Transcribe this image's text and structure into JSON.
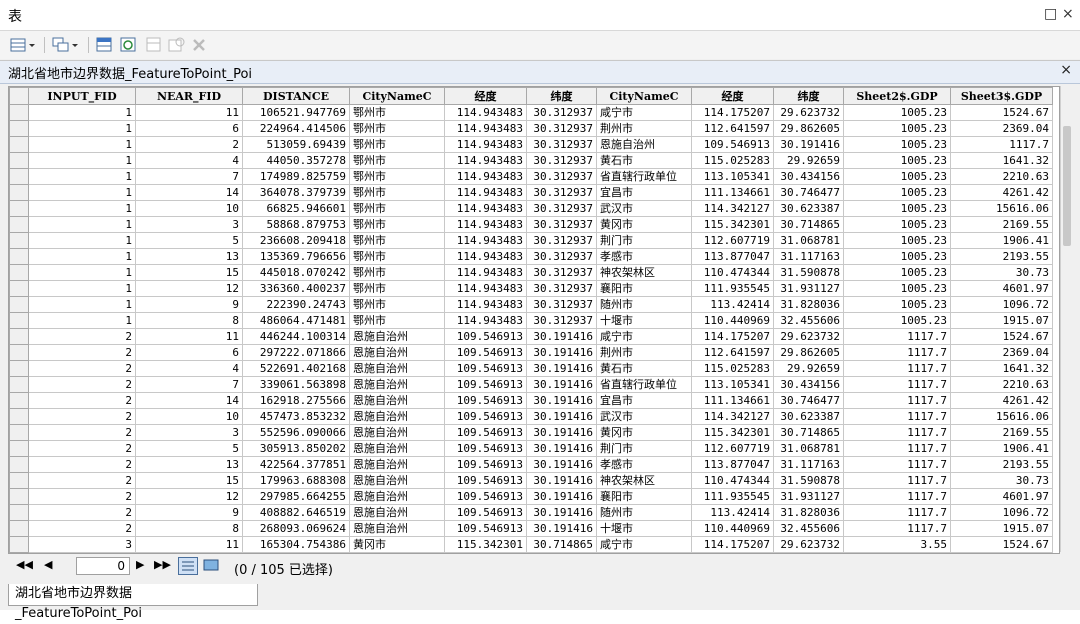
{
  "window": {
    "title": "表",
    "maximize_glyph": "□",
    "close_glyph": "×"
  },
  "toolbar": {
    "icons": [
      "table-options-icon",
      "related-tables-icon",
      "select-by-attributes-icon",
      "switch-selection-icon",
      "clear-selection-icon",
      "zoom-to-selected-icon",
      "delete-selected-icon"
    ]
  },
  "tab": {
    "title": "湖北省地市边界数据_FeatureToPoint_Poi",
    "close_glyph": "×"
  },
  "columns": [
    "",
    "INPUT_FID",
    "NEAR_FID",
    "DISTANCE",
    "CityNameC",
    "经度",
    "纬度",
    "CityNameC",
    "经度",
    "纬度",
    "Sheet2$.GDP",
    "Sheet3$.GDP"
  ],
  "rows": [
    [
      "1",
      "11",
      "106521.947769",
      "鄂州市",
      "114.943483",
      "30.312937",
      "咸宁市",
      "114.175207",
      "29.623732",
      "1005.23",
      "1524.67"
    ],
    [
      "1",
      "6",
      "224964.414506",
      "鄂州市",
      "114.943483",
      "30.312937",
      "荆州市",
      "112.641597",
      "29.862605",
      "1005.23",
      "2369.04"
    ],
    [
      "1",
      "2",
      "513059.69439",
      "鄂州市",
      "114.943483",
      "30.312937",
      "恩施自治州",
      "109.546913",
      "30.191416",
      "1005.23",
      "1117.7"
    ],
    [
      "1",
      "4",
      "44050.357278",
      "鄂州市",
      "114.943483",
      "30.312937",
      "黄石市",
      "115.025283",
      "29.92659",
      "1005.23",
      "1641.32"
    ],
    [
      "1",
      "7",
      "174989.825759",
      "鄂州市",
      "114.943483",
      "30.312937",
      "省直辖行政单位",
      "113.105341",
      "30.434156",
      "1005.23",
      "2210.63"
    ],
    [
      "1",
      "14",
      "364078.379739",
      "鄂州市",
      "114.943483",
      "30.312937",
      "宜昌市",
      "111.134661",
      "30.746477",
      "1005.23",
      "4261.42"
    ],
    [
      "1",
      "10",
      "66825.946601",
      "鄂州市",
      "114.943483",
      "30.312937",
      "武汉市",
      "114.342127",
      "30.623387",
      "1005.23",
      "15616.06"
    ],
    [
      "1",
      "3",
      "58868.879753",
      "鄂州市",
      "114.943483",
      "30.312937",
      "黄冈市",
      "115.342301",
      "30.714865",
      "1005.23",
      "2169.55"
    ],
    [
      "1",
      "5",
      "236608.209418",
      "鄂州市",
      "114.943483",
      "30.312937",
      "荆门市",
      "112.607719",
      "31.068781",
      "1005.23",
      "1906.41"
    ],
    [
      "1",
      "13",
      "135369.796656",
      "鄂州市",
      "114.943483",
      "30.312937",
      "孝感市",
      "113.877047",
      "31.117163",
      "1005.23",
      "2193.55"
    ],
    [
      "1",
      "15",
      "445018.070242",
      "鄂州市",
      "114.943483",
      "30.312937",
      "神农架林区",
      "110.474344",
      "31.590878",
      "1005.23",
      "30.73"
    ],
    [
      "1",
      "12",
      "336360.400237",
      "鄂州市",
      "114.943483",
      "30.312937",
      "襄阳市",
      "111.935545",
      "31.931127",
      "1005.23",
      "4601.97"
    ],
    [
      "1",
      "9",
      "222390.24743",
      "鄂州市",
      "114.943483",
      "30.312937",
      "随州市",
      "113.42414",
      "31.828036",
      "1005.23",
      "1096.72"
    ],
    [
      "1",
      "8",
      "486064.471481",
      "鄂州市",
      "114.943483",
      "30.312937",
      "十堰市",
      "110.440969",
      "32.455606",
      "1005.23",
      "1915.07"
    ],
    [
      "2",
      "11",
      "446244.100314",
      "恩施自治州",
      "109.546913",
      "30.191416",
      "咸宁市",
      "114.175207",
      "29.623732",
      "1117.7",
      "1524.67"
    ],
    [
      "2",
      "6",
      "297222.071866",
      "恩施自治州",
      "109.546913",
      "30.191416",
      "荆州市",
      "112.641597",
      "29.862605",
      "1117.7",
      "2369.04"
    ],
    [
      "2",
      "4",
      "522691.402168",
      "恩施自治州",
      "109.546913",
      "30.191416",
      "黄石市",
      "115.025283",
      "29.92659",
      "1117.7",
      "1641.32"
    ],
    [
      "2",
      "7",
      "339061.563898",
      "恩施自治州",
      "109.546913",
      "30.191416",
      "省直辖行政单位",
      "113.105341",
      "30.434156",
      "1117.7",
      "2210.63"
    ],
    [
      "2",
      "14",
      "162918.275566",
      "恩施自治州",
      "109.546913",
      "30.191416",
      "宜昌市",
      "111.134661",
      "30.746477",
      "1117.7",
      "4261.42"
    ],
    [
      "2",
      "10",
      "457473.853232",
      "恩施自治州",
      "109.546913",
      "30.191416",
      "武汉市",
      "114.342127",
      "30.623387",
      "1117.7",
      "15616.06"
    ],
    [
      "2",
      "3",
      "552596.090066",
      "恩施自治州",
      "109.546913",
      "30.191416",
      "黄冈市",
      "115.342301",
      "30.714865",
      "1117.7",
      "2169.55"
    ],
    [
      "2",
      "5",
      "305913.850202",
      "恩施自治州",
      "109.546913",
      "30.191416",
      "荆门市",
      "112.607719",
      "31.068781",
      "1117.7",
      "1906.41"
    ],
    [
      "2",
      "13",
      "422564.377851",
      "恩施自治州",
      "109.546913",
      "30.191416",
      "孝感市",
      "113.877047",
      "31.117163",
      "1117.7",
      "2193.55"
    ],
    [
      "2",
      "15",
      "179963.688308",
      "恩施自治州",
      "109.546913",
      "30.191416",
      "神农架林区",
      "110.474344",
      "31.590878",
      "1117.7",
      "30.73"
    ],
    [
      "2",
      "12",
      "297985.664255",
      "恩施自治州",
      "109.546913",
      "30.191416",
      "襄阳市",
      "111.935545",
      "31.931127",
      "1117.7",
      "4601.97"
    ],
    [
      "2",
      "9",
      "408882.646519",
      "恩施自治州",
      "109.546913",
      "30.191416",
      "随州市",
      "113.42414",
      "31.828036",
      "1117.7",
      "1096.72"
    ],
    [
      "2",
      "8",
      "268093.069624",
      "恩施自治州",
      "109.546913",
      "30.191416",
      "十堰市",
      "110.440969",
      "32.455606",
      "1117.7",
      "1915.07"
    ],
    [
      "3",
      "11",
      "165304.754386",
      "黄冈市",
      "115.342301",
      "30.714865",
      "咸宁市",
      "114.175207",
      "29.623732",
      "3.55",
      "1524.67"
    ]
  ],
  "navigation": {
    "record_value": "0",
    "first": "◀◀",
    "prev": "◀",
    "next": "▶",
    "last": "▶▶"
  },
  "status": "(0 / 105 已选择)",
  "bottom_tab": {
    "title": "湖北省地市边界数据_FeatureToPoint_Poi"
  },
  "colors": {
    "header_bg": "#f0f0f0",
    "tab_bg": "#e8eef7",
    "grid_border": "#c8c8c8"
  }
}
